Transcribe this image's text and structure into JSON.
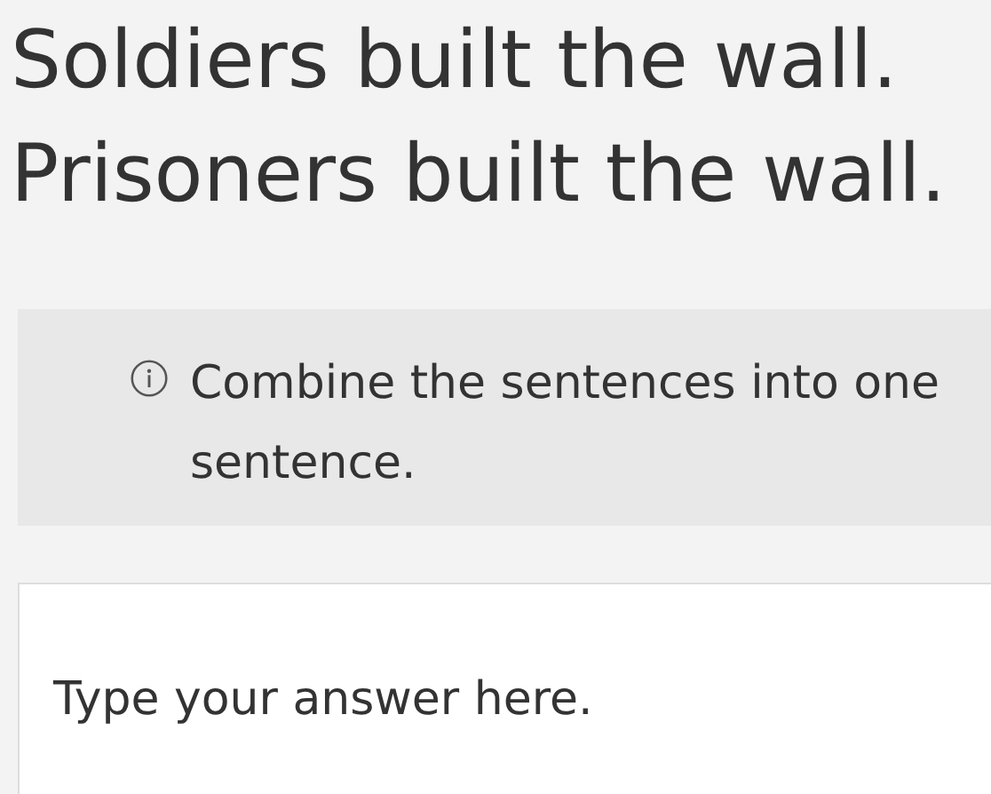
{
  "sentences": [
    "Soldiers built the wall.",
    "Prisoners built the wall."
  ],
  "instruction": "Combine the sentences into one sentence.",
  "answer": {
    "placeholder": "Type your answer here."
  }
}
